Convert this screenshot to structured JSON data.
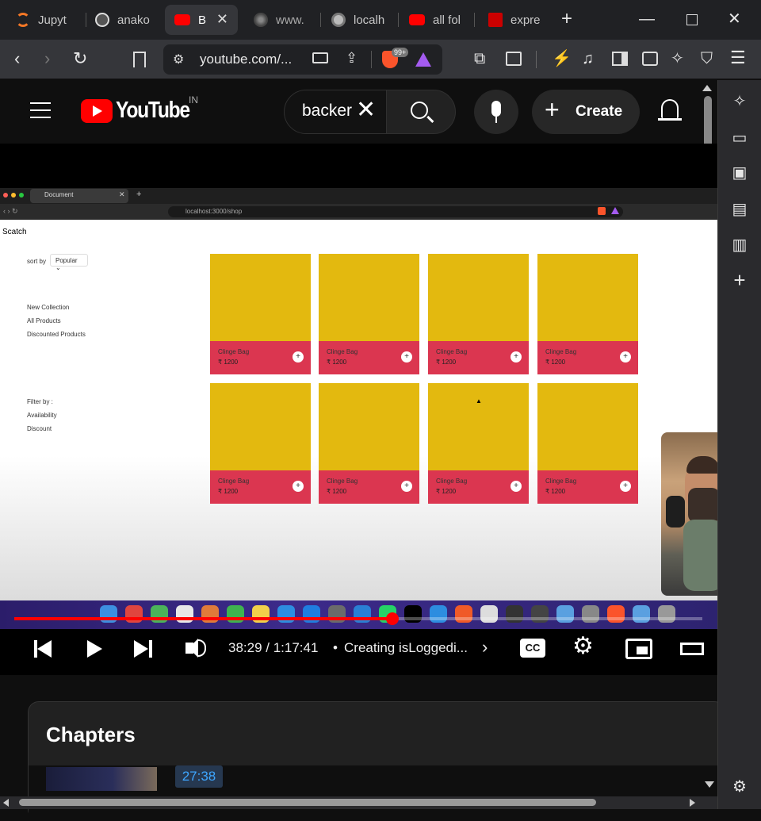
{
  "tabs": [
    {
      "label": "Jupyt",
      "icon": "jupyter-icon",
      "active": false
    },
    {
      "label": "anako",
      "icon": "brave-search-icon",
      "active": false
    },
    {
      "label": "B",
      "icon": "youtube-icon",
      "active": true
    },
    {
      "label": "www.",
      "icon": "perplexity-icon",
      "active": false
    },
    {
      "label": "localh",
      "icon": "globe-icon",
      "active": false
    },
    {
      "label": "all fol",
      "icon": "youtube-icon",
      "active": false
    },
    {
      "label": "expre",
      "icon": "npm-icon",
      "active": false
    }
  ],
  "address": {
    "url": "youtube.com/...",
    "badge_count": "99+"
  },
  "youtube": {
    "region": "IN",
    "search_value": "backer",
    "create_label": "Create"
  },
  "video": {
    "inner_tab_title": "Document",
    "inner_url": "localhost:3000/shop",
    "brand": "Scatch",
    "sort_label": "sort by",
    "sort_value": "Popular",
    "nav_links": [
      "New Collection",
      "All Products",
      "Discounted Products"
    ],
    "filter_label": "Filter by :",
    "filters": [
      "Availability",
      "Discount"
    ],
    "products": [
      {
        "name": "Clinge Bag",
        "price": "₹ 1200"
      },
      {
        "name": "Clinge Bag",
        "price": "₹ 1200"
      },
      {
        "name": "Clinge Bag",
        "price": "₹ 1200"
      },
      {
        "name": "Clinge Bag",
        "price": "₹ 1200"
      },
      {
        "name": "Clinge Bag",
        "price": "₹ 1200"
      },
      {
        "name": "Clinge Bag",
        "price": "₹ 1200"
      },
      {
        "name": "Clinge Bag",
        "price": "₹ 1200"
      },
      {
        "name": "Clinge Bag",
        "price": "₹ 1200"
      }
    ],
    "progress_fraction": 0.55
  },
  "player": {
    "time": "38:29 / 1:17:41",
    "chapter_title": "Creating isLoggedi..."
  },
  "chapters": {
    "heading": "Chapters",
    "first_timestamp": "27:38"
  },
  "colors": {
    "accent_red": "#ff0000",
    "product_yellow": "#e3b90f",
    "product_red": "#db3650"
  }
}
